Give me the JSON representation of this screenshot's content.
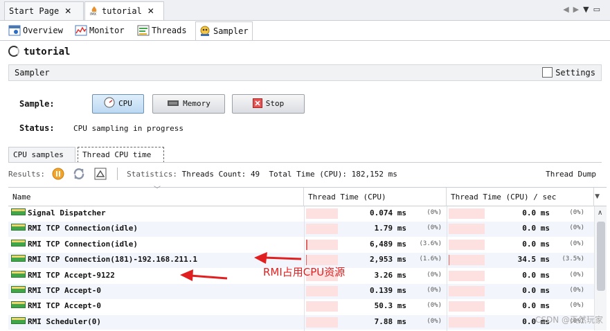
{
  "doc_tabs": [
    {
      "label": "Start Page",
      "active": false
    },
    {
      "label": "tutorial",
      "active": true
    }
  ],
  "view_tabs": [
    {
      "label": "Overview",
      "icon": "overview-icon"
    },
    {
      "label": "Monitor",
      "icon": "monitor-icon"
    },
    {
      "label": "Threads",
      "icon": "threads-icon"
    },
    {
      "label": "Sampler",
      "icon": "sampler-icon",
      "active": true
    }
  ],
  "app": {
    "title": "tutorial"
  },
  "sampler": {
    "section_label": "Sampler",
    "settings_label": "Settings",
    "sample_label": "Sample:",
    "buttons": {
      "cpu": "CPU",
      "memory": "Memory",
      "stop": "Stop"
    },
    "status_label": "Status:",
    "status_text": "CPU sampling in progress"
  },
  "sub_tabs": [
    {
      "label": "CPU samples",
      "active": false
    },
    {
      "label": "Thread CPU time",
      "active": true
    }
  ],
  "results": {
    "label": "Results:",
    "statistics_label": "Statistics:",
    "threads_count_label": "Threads Count:",
    "threads_count": "49",
    "total_time_label": "Total Time (CPU):",
    "total_time": "182,152 ms",
    "thread_dump": "Thread Dump"
  },
  "table": {
    "columns": [
      "Name",
      "Thread Time (CPU)",
      "Thread Time (CPU) / sec"
    ],
    "rows": [
      {
        "name": "Signal Dispatcher",
        "time": "0.074 ms",
        "time_pct": "(0%)",
        "time_frac": 0.0,
        "rate": "0.0 ms",
        "rate_pct": "(0%)",
        "rate_frac": 0.0
      },
      {
        "name": "RMI TCP Connection(idle)",
        "time": "1.79 ms",
        "time_pct": "(0%)",
        "time_frac": 0.0,
        "rate": "0.0 ms",
        "rate_pct": "(0%)",
        "rate_frac": 0.0
      },
      {
        "name": "RMI TCP Connection(idle)",
        "time": "6,489 ms",
        "time_pct": "(3.6%)",
        "time_frac": 0.036,
        "rate": "0.0 ms",
        "rate_pct": "(0%)",
        "rate_frac": 0.0
      },
      {
        "name": "RMI TCP Connection(181)-192.168.211.1",
        "time": "2,953 ms",
        "time_pct": "(1.6%)",
        "time_frac": 0.016,
        "rate": "34.5 ms",
        "rate_pct": "(3.5%)",
        "rate_frac": 0.035
      },
      {
        "name": "RMI TCP Accept-9122",
        "time": "3.26 ms",
        "time_pct": "(0%)",
        "time_frac": 0.0,
        "rate": "0.0 ms",
        "rate_pct": "(0%)",
        "rate_frac": 0.0
      },
      {
        "name": "RMI TCP Accept-0",
        "time": "0.139 ms",
        "time_pct": "(0%)",
        "time_frac": 0.0,
        "rate": "0.0 ms",
        "rate_pct": "(0%)",
        "rate_frac": 0.0
      },
      {
        "name": "RMI TCP Accept-0",
        "time": "50.3 ms",
        "time_pct": "(0%)",
        "time_frac": 0.0,
        "rate": "0.0 ms",
        "rate_pct": "(0%)",
        "rate_frac": 0.0
      },
      {
        "name": "RMI Scheduler(0)",
        "time": "7.88 ms",
        "time_pct": "(0%)",
        "time_frac": 0.0,
        "rate": "0.0 ms",
        "rate_pct": "(0%)",
        "rate_frac": 0.0
      }
    ]
  },
  "annotation": {
    "text": "RMI占用CPU资源",
    "color": "#e02020"
  },
  "watermark": "CSDN @天然玩家",
  "colors": {
    "bar_bg": "#fde0e0",
    "bar_fill": "#e06666",
    "row_alt": "#f2f5fb"
  }
}
